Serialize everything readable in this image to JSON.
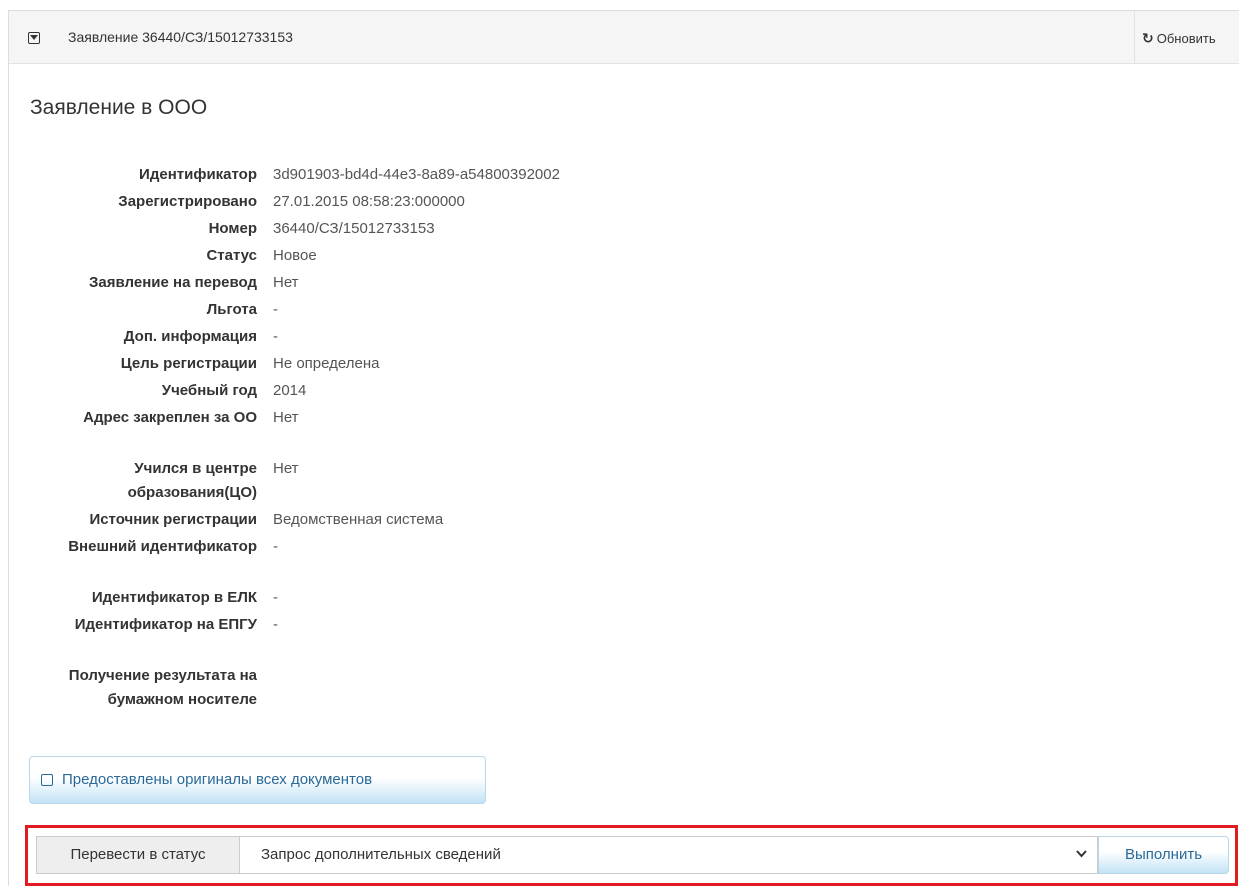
{
  "header": {
    "title": "Заявление 36440/СЗ/15012733153",
    "refresh_label": "Обновить"
  },
  "app": {
    "title": "Заявление в ООО"
  },
  "details": [
    {
      "label": "Идентификатор",
      "value": "3d901903-bd4d-44e3-8a89-a54800392002"
    },
    {
      "label": "Зарегистрировано",
      "value": "27.01.2015 08:58:23:000000"
    },
    {
      "label": "Номер",
      "value": "36440/СЗ/15012733153"
    },
    {
      "label": "Статус",
      "value": "Новое"
    },
    {
      "label": "Заявление на перевод",
      "value": "Нет"
    },
    {
      "label": "Льгота",
      "value": "-"
    },
    {
      "label": "Доп. информация",
      "value": "-"
    },
    {
      "label": "Цель регистрации",
      "value": "Не определена"
    },
    {
      "label": "Учебный год",
      "value": "2014"
    },
    {
      "label": "Адрес закреплен за ОО",
      "value": "Нет"
    },
    {
      "label": "Учился в центре образования(ЦО)",
      "value": "Нет"
    },
    {
      "label": "Источник регистрации",
      "value": "Ведомственная система"
    },
    {
      "label": "Внешний идентификатор",
      "value": "-"
    },
    {
      "label": "Идентификатор в ЕЛК",
      "value": "-"
    },
    {
      "label": "Идентификатор на ЕПГУ",
      "value": "-"
    },
    {
      "label": "Получение результата на бумажном носителе",
      "value": ""
    }
  ],
  "originals_button": {
    "label": "Предоставлены оригиналы всех документов"
  },
  "status_change": {
    "label": "Перевести в статус",
    "selected": "Запрос дополнительных сведений",
    "execute_label": "Выполнить"
  },
  "colors": {
    "highlight_border": "#e11b22",
    "button_text": "#2a6a98",
    "button_gradient_bottom": "#c2e3f6"
  }
}
